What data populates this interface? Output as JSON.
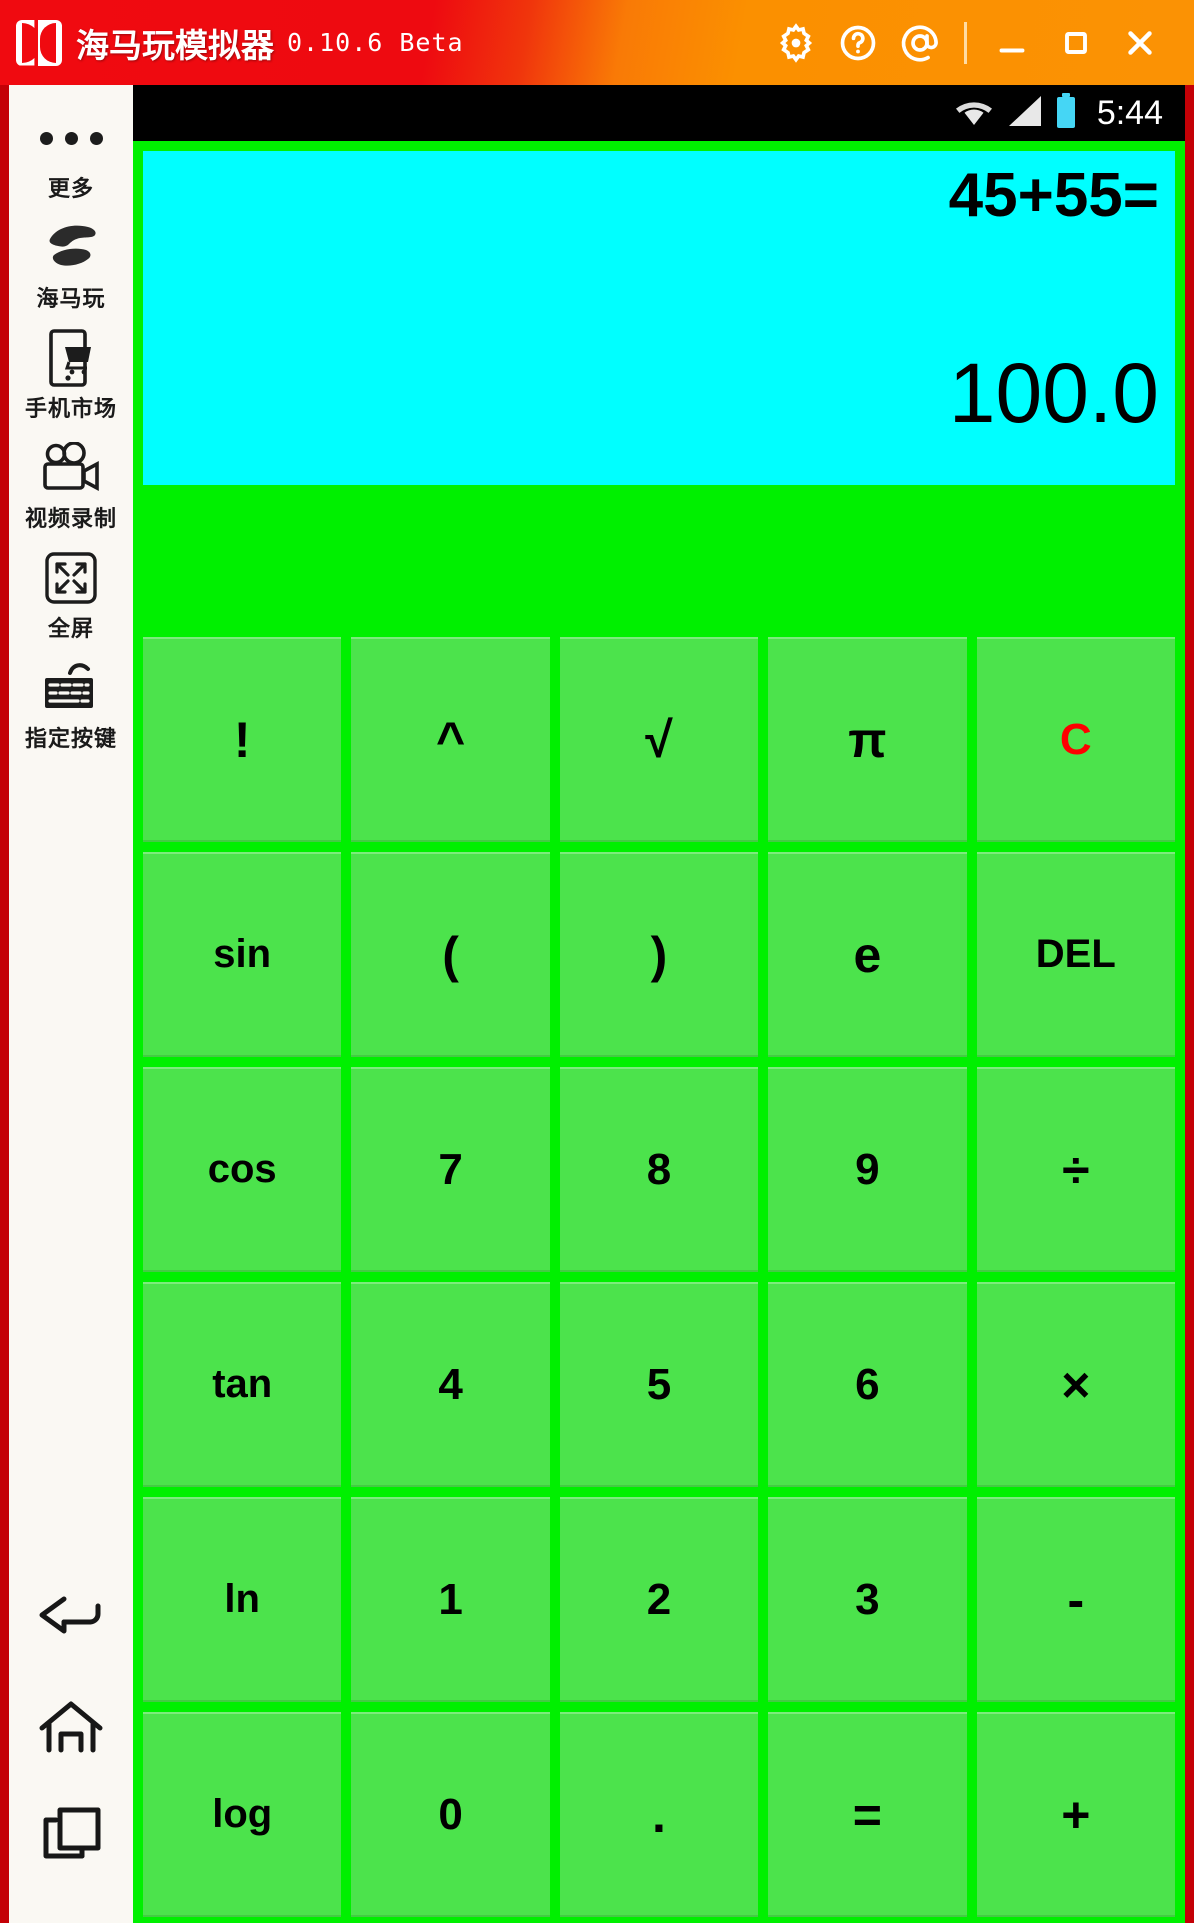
{
  "window": {
    "app_title": "海马玩模拟器",
    "version": "0.10.6 Beta",
    "logo_icon": "droid4x-logo-icon",
    "controls": {
      "settings_icon": "gear-icon",
      "help_icon": "question-circle-icon",
      "account_icon": "at-sign-icon",
      "minimize_label": "—",
      "maximize_label": "□",
      "close_label": "✕"
    }
  },
  "sidebar": {
    "items": [
      {
        "label": "更多",
        "icon": "more-dots-icon"
      },
      {
        "label": "海马玩",
        "icon": "haimawan-logo-icon"
      },
      {
        "label": "手机市场",
        "icon": "app-store-phone-icon"
      },
      {
        "label": "视频录制",
        "icon": "video-camera-icon"
      },
      {
        "label": "全屏",
        "icon": "fullscreen-expand-icon"
      },
      {
        "label": "指定按键",
        "icon": "keyboard-mapping-icon"
      }
    ],
    "nav": [
      {
        "name": "back",
        "icon": "back-arrow-icon"
      },
      {
        "name": "home",
        "icon": "home-icon"
      },
      {
        "name": "recents",
        "icon": "recent-apps-icon"
      }
    ]
  },
  "statusbar": {
    "wifi_icon": "wifi-icon",
    "signal_icon": "cellular-signal-icon",
    "battery_icon": "battery-icon",
    "time": "5:44"
  },
  "calculator": {
    "expression": "45+55=",
    "result": "100.0",
    "display_bg": "#00ffff",
    "keypad_bg": "#00f000",
    "key_bg": "#4ce34c",
    "clear_color": "#ff0000",
    "keys": [
      {
        "label": "!",
        "name": "factorial",
        "style": "sym"
      },
      {
        "label": "^",
        "name": "power",
        "style": "sym"
      },
      {
        "label": "√",
        "name": "sqrt",
        "style": "sym"
      },
      {
        "label": "π",
        "name": "pi",
        "style": "sym"
      },
      {
        "label": "C",
        "name": "clear",
        "style": "red"
      },
      {
        "label": "sin",
        "name": "sin",
        "style": "small"
      },
      {
        "label": "(",
        "name": "open-paren",
        "style": "sym"
      },
      {
        "label": ")",
        "name": "close-paren",
        "style": "sym"
      },
      {
        "label": "e",
        "name": "euler",
        "style": "sym"
      },
      {
        "label": "DEL",
        "name": "delete",
        "style": "small"
      },
      {
        "label": "cos",
        "name": "cos",
        "style": "small"
      },
      {
        "label": "7",
        "name": "digit-7",
        "style": ""
      },
      {
        "label": "8",
        "name": "digit-8",
        "style": ""
      },
      {
        "label": "9",
        "name": "digit-9",
        "style": ""
      },
      {
        "label": "÷",
        "name": "divide",
        "style": "sym"
      },
      {
        "label": "tan",
        "name": "tan",
        "style": "small"
      },
      {
        "label": "4",
        "name": "digit-4",
        "style": ""
      },
      {
        "label": "5",
        "name": "digit-5",
        "style": ""
      },
      {
        "label": "6",
        "name": "digit-6",
        "style": ""
      },
      {
        "label": "×",
        "name": "multiply",
        "style": "sym"
      },
      {
        "label": "ln",
        "name": "ln",
        "style": "small"
      },
      {
        "label": "1",
        "name": "digit-1",
        "style": ""
      },
      {
        "label": "2",
        "name": "digit-2",
        "style": ""
      },
      {
        "label": "3",
        "name": "digit-3",
        "style": ""
      },
      {
        "label": "-",
        "name": "minus",
        "style": "sym"
      },
      {
        "label": "log",
        "name": "log",
        "style": "small"
      },
      {
        "label": "0",
        "name": "digit-0",
        "style": ""
      },
      {
        "label": ".",
        "name": "decimal",
        "style": "sym"
      },
      {
        "label": "=",
        "name": "equals",
        "style": "sym"
      },
      {
        "label": "+",
        "name": "plus",
        "style": "sym"
      }
    ]
  }
}
